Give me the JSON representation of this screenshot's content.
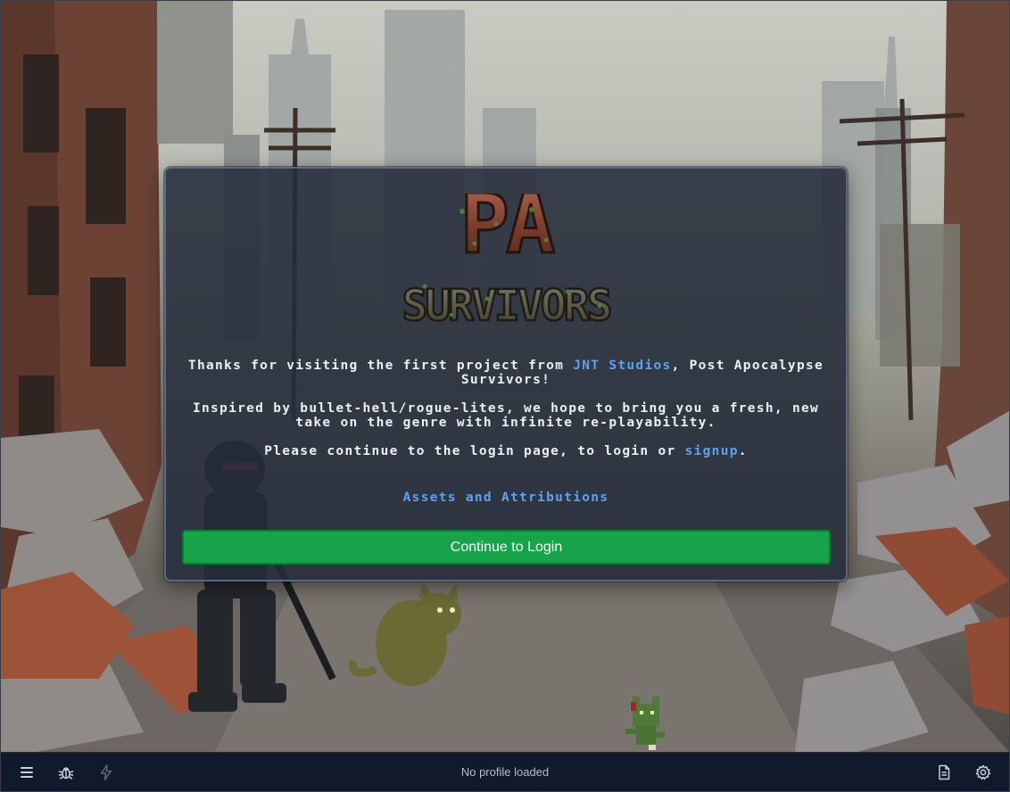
{
  "logo": {
    "line1": "PA",
    "line2": "SURVIVORS"
  },
  "intro": {
    "p1_prefix": "Thanks for visiting the first project from ",
    "p1_link": "JNT Studios",
    "p1_suffix": ", Post Apocalypse Survivors!",
    "p2": "Inspired by bullet-hell/rogue-lites, we hope to bring you a fresh, new take on the genre with infinite re-playability.",
    "p3_prefix": "Please continue to the login page, to login or ",
    "p3_link": "signup",
    "p3_suffix": ".",
    "attributions_link": "Assets and Attributions"
  },
  "continue_button": "Continue to Login",
  "bottom_bar": {
    "status": "No profile loaded",
    "icons": [
      "menu-icon",
      "bug-icon",
      "lightning-icon",
      "document-icon",
      "gear-icon"
    ]
  },
  "colors": {
    "card_bg": "#242c3a",
    "link": "#5aa2f5",
    "button": "#16a34a",
    "bar_bg": "#111a2c"
  }
}
